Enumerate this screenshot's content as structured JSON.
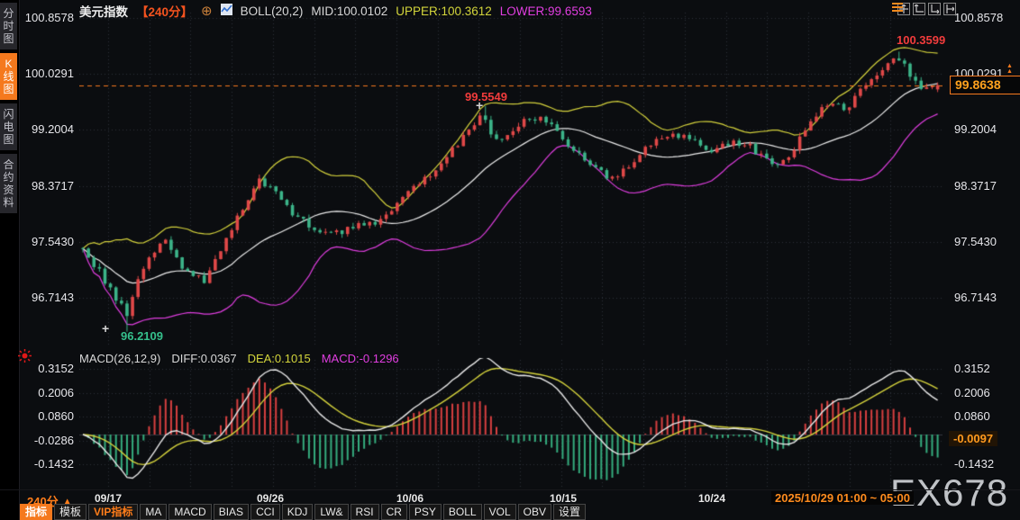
{
  "header": {
    "symbol": "美元指数",
    "period": "【240分】",
    "boll_label": "BOLL(20,2)",
    "mid": "MID:100.0102",
    "upper": "UPPER:100.3612",
    "lower": "LOWER:99.6593"
  },
  "icons": {
    "circle_plus": "⊕",
    "up_arrow": "▲",
    "double_up_arrow": "▲▲"
  },
  "sidebar": {
    "tabs": [
      {
        "label": "分时图",
        "active": false
      },
      {
        "label": "K线图",
        "active": true
      },
      {
        "label": "闪电图",
        "active": false
      },
      {
        "label": "合约资料",
        "active": false
      }
    ]
  },
  "macd_header": {
    "title": "MACD(26,12,9)",
    "diff": "DIFF:0.0367",
    "dea": "DEA:0.1015",
    "macd": "MACD:-0.1296"
  },
  "price_badge": "99.8638",
  "macd_badge": "-0.0097",
  "annotations": {
    "swing_high": {
      "label": "99.5549",
      "frac": 0.468,
      "price": 99.5549
    },
    "low": {
      "label": "96.2109",
      "frac": 0.051,
      "price": 96.2109
    },
    "recent_high": {
      "label": "100.3599",
      "frac": 0.953,
      "price": 100.3599
    }
  },
  "bottom": {
    "period_label": "240分",
    "session_label": "2025/10/29 01:00 ~ 05:00"
  },
  "watermark": "EX678",
  "toolbar": {
    "items": [
      {
        "label": "指标",
        "style": "active"
      },
      {
        "label": "模板",
        "style": "normal"
      },
      {
        "label": "VIP指标",
        "style": "vip"
      },
      {
        "label": "MA",
        "style": "normal"
      },
      {
        "label": "MACD",
        "style": "normal"
      },
      {
        "label": "BIAS",
        "style": "normal"
      },
      {
        "label": "CCI",
        "style": "normal"
      },
      {
        "label": "KDJ",
        "style": "normal"
      },
      {
        "label": "LW&",
        "style": "normal"
      },
      {
        "label": "RSI",
        "style": "normal"
      },
      {
        "label": "CR",
        "style": "normal"
      },
      {
        "label": "PSY",
        "style": "normal"
      },
      {
        "label": "BOLL",
        "style": "normal"
      },
      {
        "label": "VOL",
        "style": "normal"
      },
      {
        "label": "OBV",
        "style": "normal"
      },
      {
        "label": "设置",
        "style": "normal"
      }
    ]
  },
  "colors": {
    "accent_orange": "#f5791d",
    "candle_up": "#e04848",
    "candle_down": "#3cb489",
    "boll_upper": "#d4d23c",
    "boll_mid": "#ececec",
    "boll_lower": "#e03ee0",
    "macd_diff_line": "#e8e8e8",
    "macd_dea_line": "#d4d23c",
    "hist_pos": "#d94040",
    "hist_neg": "#35ad7e",
    "grid": "#2e3138",
    "red_label": "#f23c3c",
    "green_label": "#35c08c"
  },
  "chart_data": {
    "type": "candlestick+macd",
    "symbol": "美元指数",
    "interval": "240分",
    "y_axis_tick_labels": [
      "100.8578",
      "100.0291",
      "99.2004",
      "98.3717",
      "97.5430",
      "96.7143"
    ],
    "macd_tick_labels": [
      "0.3152",
      "0.2006",
      "0.0860",
      "-0.0286",
      "-0.1432"
    ],
    "x_tick_labels": [
      "09/17",
      "09/26",
      "10/06",
      "10/15",
      "10/24"
    ],
    "last_price": 99.8638,
    "session": "2025/10/29 01:00 ~ 05:00",
    "boll": {
      "period": 20,
      "k": 2,
      "mid": 100.0102,
      "upper": 100.3612,
      "lower": 99.6593
    },
    "macd": {
      "params": [
        26,
        12,
        9
      ],
      "diff": 0.0367,
      "dea": 0.1015,
      "macd": -0.1296,
      "last_hist": -0.0097
    },
    "extremes": {
      "recent_high": 100.3599,
      "swing_high": 99.5549,
      "low": 96.2109
    },
    "price_keypoints": [
      [
        0.0,
        97.45
      ],
      [
        0.019,
        97.1
      ],
      [
        0.035,
        96.8
      ],
      [
        0.051,
        96.45
      ],
      [
        0.063,
        97.0
      ],
      [
        0.082,
        97.4
      ],
      [
        0.098,
        97.55
      ],
      [
        0.119,
        97.1
      ],
      [
        0.143,
        96.95
      ],
      [
        0.169,
        97.6
      ],
      [
        0.204,
        98.45
      ],
      [
        0.222,
        98.3
      ],
      [
        0.243,
        98.0
      ],
      [
        0.269,
        97.75
      ],
      [
        0.295,
        97.65
      ],
      [
        0.322,
        97.8
      ],
      [
        0.348,
        97.85
      ],
      [
        0.38,
        98.3
      ],
      [
        0.406,
        98.55
      ],
      [
        0.432,
        98.9
      ],
      [
        0.454,
        99.2
      ],
      [
        0.468,
        99.45
      ],
      [
        0.482,
        99.05
      ],
      [
        0.496,
        99.15
      ],
      [
        0.517,
        99.35
      ],
      [
        0.538,
        99.42
      ],
      [
        0.554,
        99.15
      ],
      [
        0.575,
        98.9
      ],
      [
        0.596,
        98.7
      ],
      [
        0.617,
        98.45
      ],
      [
        0.633,
        98.6
      ],
      [
        0.654,
        98.9
      ],
      [
        0.675,
        99.1
      ],
      [
        0.696,
        99.12
      ],
      [
        0.717,
        99.0
      ],
      [
        0.738,
        98.9
      ],
      [
        0.759,
        99.05
      ],
      [
        0.781,
        98.95
      ],
      [
        0.802,
        98.72
      ],
      [
        0.817,
        98.7
      ],
      [
        0.833,
        98.95
      ],
      [
        0.849,
        99.3
      ],
      [
        0.865,
        99.55
      ],
      [
        0.881,
        99.58
      ],
      [
        0.891,
        99.48
      ],
      [
        0.907,
        99.72
      ],
      [
        0.923,
        99.95
      ],
      [
        0.939,
        100.12
      ],
      [
        0.953,
        100.28
      ],
      [
        0.967,
        100.05
      ],
      [
        0.981,
        99.82
      ],
      [
        1.0,
        99.8638
      ]
    ]
  }
}
